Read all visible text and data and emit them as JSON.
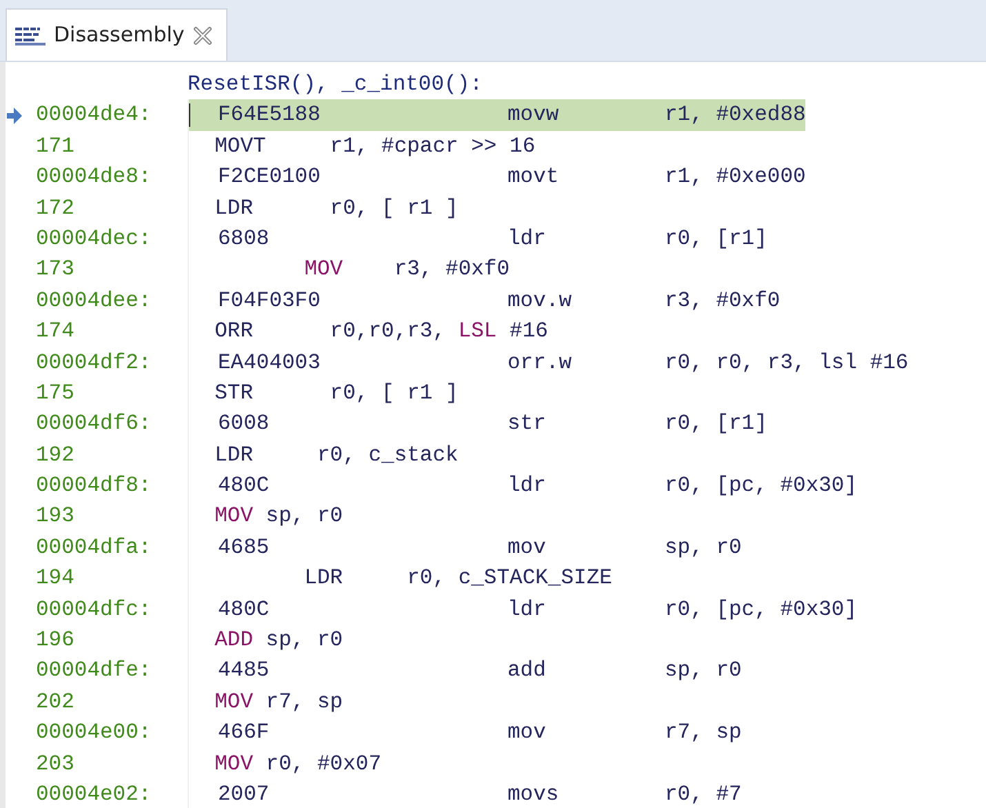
{
  "tab": {
    "label": "Disassembly",
    "selected": true
  },
  "function_header": "ResetISR(), _c_int00():",
  "rows": [
    {
      "kind": "instruction",
      "address": "00004de4:",
      "opcode": "F64E5188",
      "mnemonic": "movw",
      "operands": "r1, #0xed88",
      "current": true
    },
    {
      "kind": "source",
      "line": "171",
      "deep_indent": false,
      "segments": [
        {
          "text": "MOVT     r1, #cpacr >> 16",
          "keyword": false
        }
      ]
    },
    {
      "kind": "instruction",
      "address": "00004de8:",
      "opcode": "F2CE0100",
      "mnemonic": "movt",
      "operands": "r1, #0xe000",
      "current": false
    },
    {
      "kind": "source",
      "line": "172",
      "deep_indent": false,
      "segments": [
        {
          "text": "LDR      r0, [ r1 ]",
          "keyword": false
        }
      ]
    },
    {
      "kind": "instruction",
      "address": "00004dec:",
      "opcode": "6808",
      "mnemonic": "ldr",
      "operands": "r0, [r1]",
      "current": false
    },
    {
      "kind": "source",
      "line": "173",
      "deep_indent": true,
      "segments": [
        {
          "text": "MOV",
          "keyword": true
        },
        {
          "text": "    r3, #0xf0",
          "keyword": false
        }
      ]
    },
    {
      "kind": "instruction",
      "address": "00004dee:",
      "opcode": "F04F03F0",
      "mnemonic": "mov.w",
      "operands": "r3, #0xf0",
      "current": false
    },
    {
      "kind": "source",
      "line": "174",
      "deep_indent": false,
      "segments": [
        {
          "text": "ORR      r0,r0,r3, ",
          "keyword": false
        },
        {
          "text": "LSL",
          "keyword": true
        },
        {
          "text": " #16",
          "keyword": false
        }
      ]
    },
    {
      "kind": "instruction",
      "address": "00004df2:",
      "opcode": "EA404003",
      "mnemonic": "orr.w",
      "operands": "r0, r0, r3, lsl #16",
      "current": false
    },
    {
      "kind": "source",
      "line": "175",
      "deep_indent": false,
      "segments": [
        {
          "text": "STR      r0, [ r1 ]",
          "keyword": false
        }
      ]
    },
    {
      "kind": "instruction",
      "address": "00004df6:",
      "opcode": "6008",
      "mnemonic": "str",
      "operands": "r0, [r1]",
      "current": false
    },
    {
      "kind": "source",
      "line": "192",
      "deep_indent": false,
      "segments": [
        {
          "text": "LDR     r0, c_stack",
          "keyword": false
        }
      ]
    },
    {
      "kind": "instruction",
      "address": "00004df8:",
      "opcode": "480C",
      "mnemonic": "ldr",
      "operands": "r0, [pc, #0x30]",
      "current": false
    },
    {
      "kind": "source",
      "line": "193",
      "deep_indent": false,
      "segments": [
        {
          "text": "MOV",
          "keyword": true
        },
        {
          "text": " sp, r0",
          "keyword": false
        }
      ]
    },
    {
      "kind": "instruction",
      "address": "00004dfa:",
      "opcode": "4685",
      "mnemonic": "mov",
      "operands": "sp, r0",
      "current": false
    },
    {
      "kind": "source",
      "line": "194",
      "deep_indent": true,
      "segments": [
        {
          "text": "LDR     r0, c_STACK_SIZE",
          "keyword": false
        }
      ]
    },
    {
      "kind": "instruction",
      "address": "00004dfc:",
      "opcode": "480C",
      "mnemonic": "ldr",
      "operands": "r0, [pc, #0x30]",
      "current": false
    },
    {
      "kind": "source",
      "line": "196",
      "deep_indent": false,
      "segments": [
        {
          "text": "ADD",
          "keyword": true
        },
        {
          "text": " sp, r0",
          "keyword": false
        }
      ]
    },
    {
      "kind": "instruction",
      "address": "00004dfe:",
      "opcode": "4485",
      "mnemonic": "add",
      "operands": "sp, r0",
      "current": false
    },
    {
      "kind": "source",
      "line": "202",
      "deep_indent": false,
      "segments": [
        {
          "text": "MOV",
          "keyword": true
        },
        {
          "text": " r7, sp",
          "keyword": false
        }
      ]
    },
    {
      "kind": "instruction",
      "address": "00004e00:",
      "opcode": "466F",
      "mnemonic": "mov",
      "operands": "r7, sp",
      "current": false
    },
    {
      "kind": "source",
      "line": "203",
      "deep_indent": false,
      "segments": [
        {
          "text": "MOV",
          "keyword": true
        },
        {
          "text": " r0, #0x07",
          "keyword": false
        }
      ]
    },
    {
      "kind": "instruction",
      "address": "00004e02:",
      "opcode": "2007",
      "mnemonic": "movs",
      "operands": "r0, #7",
      "current": false
    }
  ]
}
